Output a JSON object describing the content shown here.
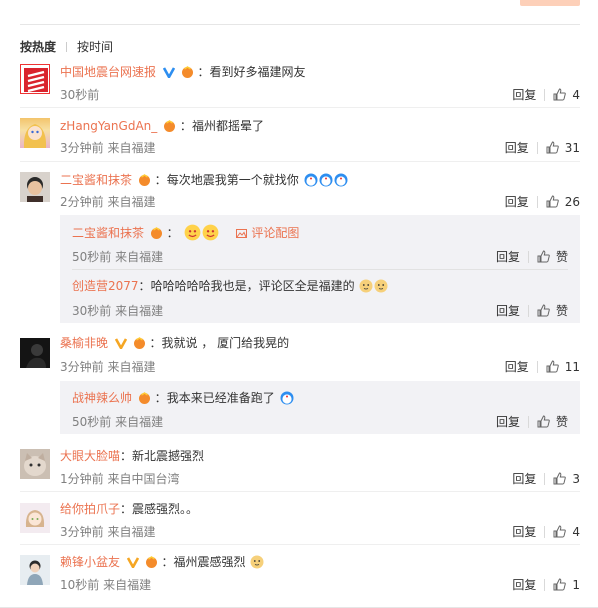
{
  "sort": {
    "hot": "按热度",
    "time": "按时间"
  },
  "actions": {
    "reply": "回复",
    "like_sub": "赞"
  },
  "colors": {
    "accent": "#eb7350",
    "meta": "#808080",
    "sub_bg": "#f2f2f5"
  },
  "comments": [
    {
      "user": "中国地震台网速报",
      "colon": "：",
      "text": "看到好多福建网友",
      "meta": "30秒前",
      "likes": "4",
      "avatar": "seismic-logo"
    },
    {
      "user": "zHangYanGdAn_",
      "colon": "：",
      "text": "福州都摇晕了",
      "meta": "3分钟前 来自福建",
      "likes": "31",
      "avatar": "anime-girl"
    },
    {
      "user": "二宝酱和抹茶",
      "colon": "：",
      "text": "每次地震我第一个就找你",
      "meta": "2分钟前 来自福建",
      "likes": "26",
      "avatar": "boy-photo"
    },
    {
      "user": "桑榆非晚",
      "colon": "：",
      "text": "我就说 ， 厦门给我晃的",
      "meta": "3分钟前 来自福建",
      "likes": "11",
      "avatar": "dark-photo"
    },
    {
      "user": "大眼大脸喵",
      "colon": "：",
      "text": "新北震撼强烈",
      "meta": "1分钟前 来自中国台湾",
      "likes": "3",
      "avatar": "cat-photo"
    },
    {
      "user": "给你拍爪子",
      "colon": "：",
      "text": "震感强烈。。",
      "meta": "3分钟前 来自福建",
      "likes": "4",
      "avatar": "cartoon-girl"
    },
    {
      "user": "赖锋小盆友",
      "colon": "：",
      "text": "福州震感强烈",
      "meta": "10秒前 来自福建",
      "likes": "1",
      "avatar": "person-photo"
    }
  ],
  "subreplies": [
    {
      "user": "二宝酱和抹茶",
      "colon": "：",
      "text": "",
      "link": "评论配图",
      "meta": "50秒前 来自福建"
    },
    {
      "user": "创造营2077",
      "colon": "：",
      "text": "哈哈哈哈哈我也是，评论区全是福建的",
      "meta": "30秒前 来自福建"
    },
    {
      "user": "战神辣么帅",
      "colon": "：",
      "text": "我本来已经准备跑了",
      "meta": "50秒前 来自福建"
    }
  ]
}
